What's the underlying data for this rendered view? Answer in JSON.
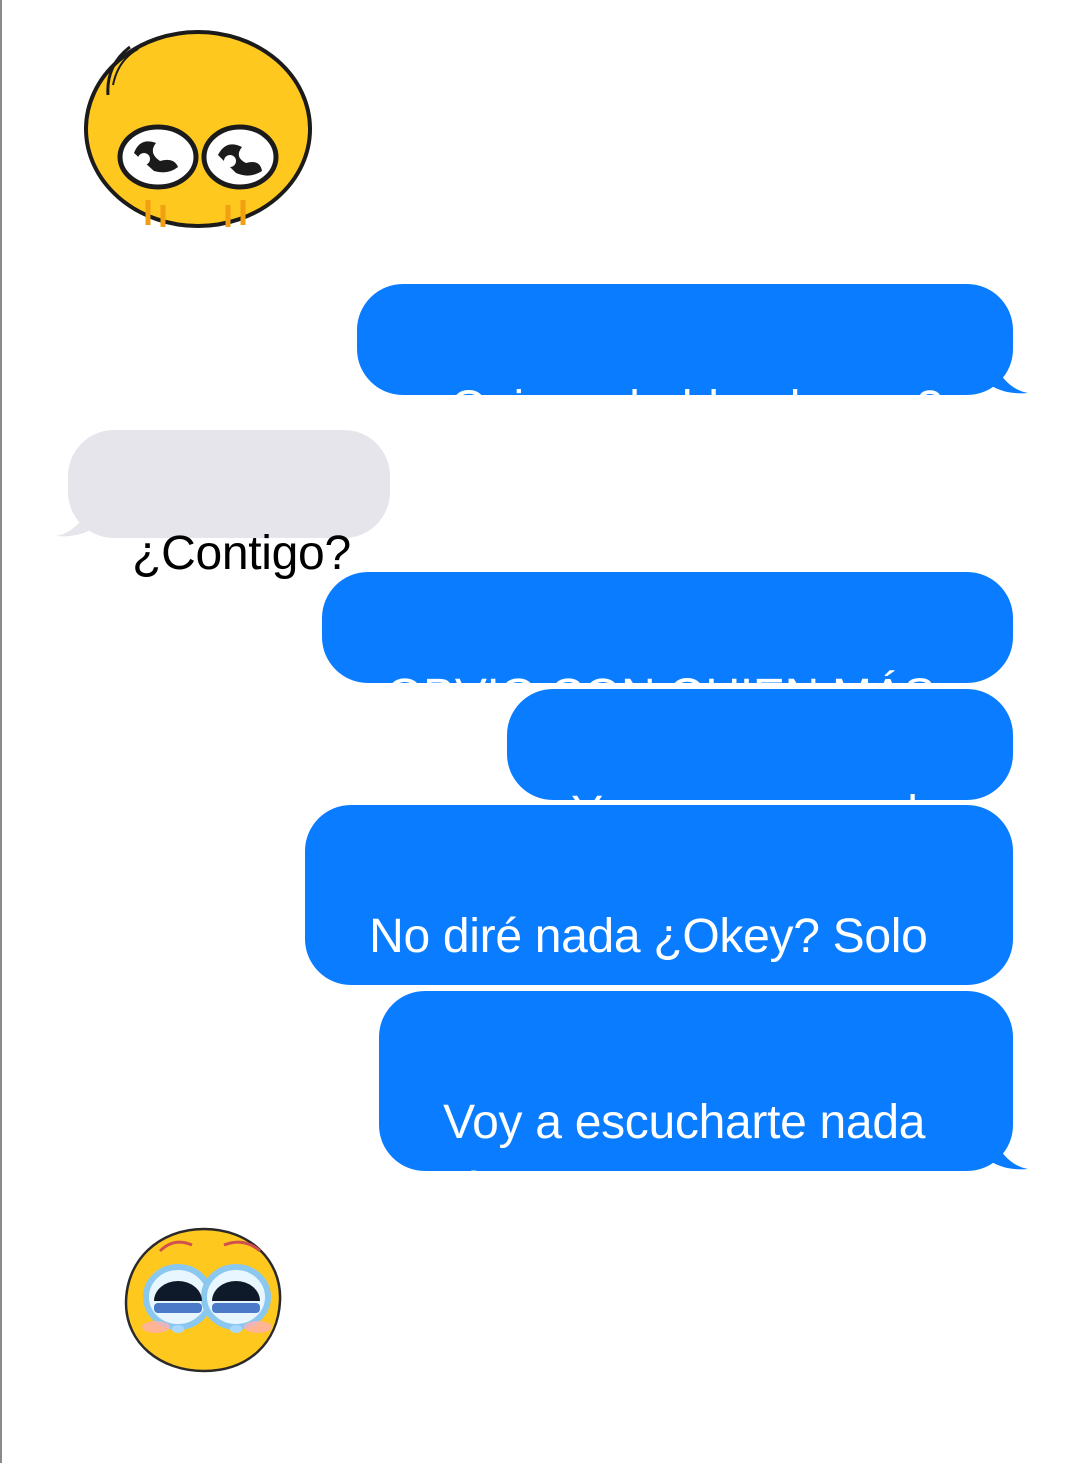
{
  "conversation": {
    "messages": [
      {
        "sender": "me",
        "text": "¿Quieres hablar de eso?"
      },
      {
        "sender": "them",
        "text": "¿Contigo?"
      },
      {
        "sender": "me",
        "text": "OBVIO CON QUIEN MÁS"
      },
      {
        "sender": "me",
        "text": "Y para no cagarla"
      },
      {
        "sender": "me",
        "text": "No diré nada ¿Okey? Solo si quieres"
      },
      {
        "sender": "me",
        "text": "Voy a escucharte nada más"
      }
    ]
  },
  "stickers": [
    {
      "icon": "shy-eyes-emoji-sticker"
    },
    {
      "icon": "teary-eyes-emoji-sticker"
    }
  ],
  "colors": {
    "sent_bubble": "#0a7cff",
    "received_bubble": "#e6e5eb",
    "emoji_yellow": "#ffc81e"
  }
}
